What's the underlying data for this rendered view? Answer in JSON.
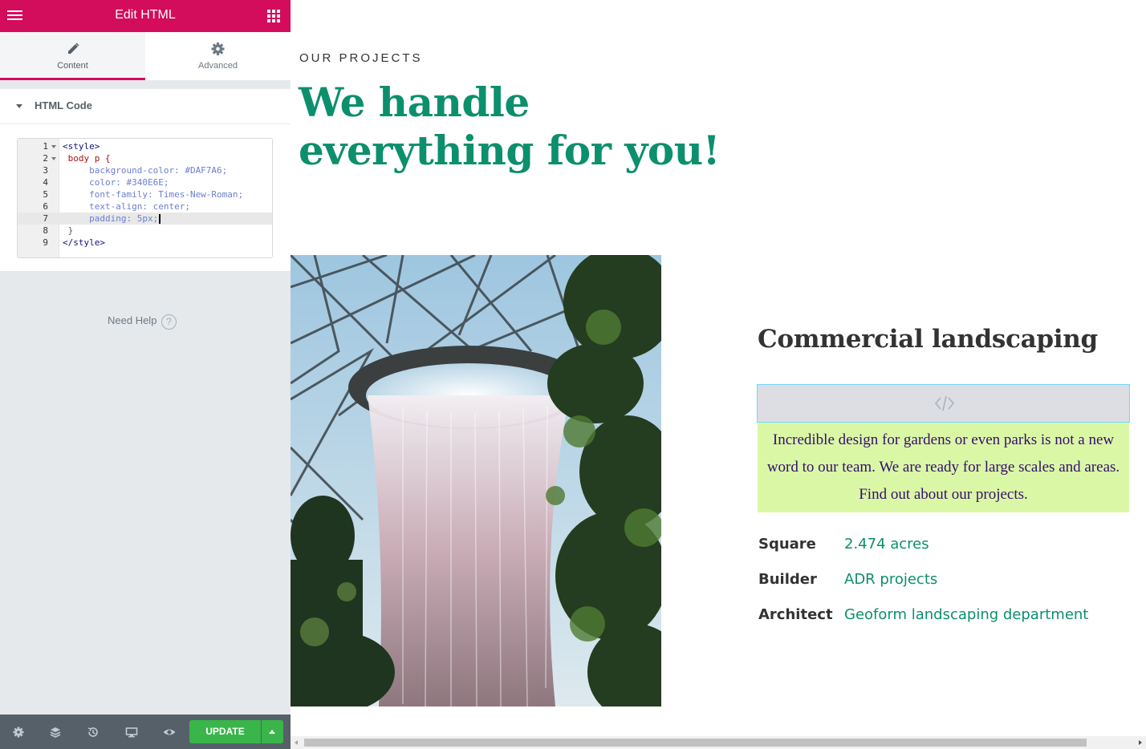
{
  "panel": {
    "title": "Edit HTML",
    "tabs": [
      {
        "label": "Content",
        "icon": "pencil-icon",
        "active": true
      },
      {
        "label": "Advanced",
        "icon": "gear-icon",
        "active": false
      }
    ],
    "section_title": "HTML Code",
    "code_lines": [
      {
        "num": "1",
        "text": "<style>"
      },
      {
        "num": "2",
        "text": " body p {"
      },
      {
        "num": "3",
        "text": "     background-color: #DAF7A6;"
      },
      {
        "num": "4",
        "text": "     color: #340E6E;"
      },
      {
        "num": "5",
        "text": "     font-family: Times-New-Roman;"
      },
      {
        "num": "6",
        "text": "     text-align: center;"
      },
      {
        "num": "7",
        "text": "     padding: 5px;"
      },
      {
        "num": "8",
        "text": " }"
      },
      {
        "num": "9",
        "text": "</style>"
      }
    ],
    "active_line": 7,
    "need_help": "Need Help",
    "footer": {
      "icons": [
        "settings-icon",
        "layers-icon",
        "history-icon",
        "responsive-icon",
        "preview-icon"
      ],
      "update_label": "UPDATE",
      "update_color": "#39b54a"
    },
    "accent_color": "#d30c5c"
  },
  "preview": {
    "eyebrow": "OUR PROJECTS",
    "hero_line1": "We handle",
    "hero_line2": "everything for you!",
    "hero_color": "#0c8f6c",
    "card_title": "Commercial landscaping",
    "description": "Incredible design for gardens or even parks is not a new word to our team. We are ready for large scales and areas. Find out about our projects.",
    "description_bg": "#DAF7A6",
    "description_color": "#340E6E",
    "specs": [
      {
        "label": "Square",
        "value": "2.474 acres"
      },
      {
        "label": "Builder",
        "value": "ADR projects"
      },
      {
        "label": "Architect",
        "value": "Geoform landscaping department"
      }
    ]
  }
}
